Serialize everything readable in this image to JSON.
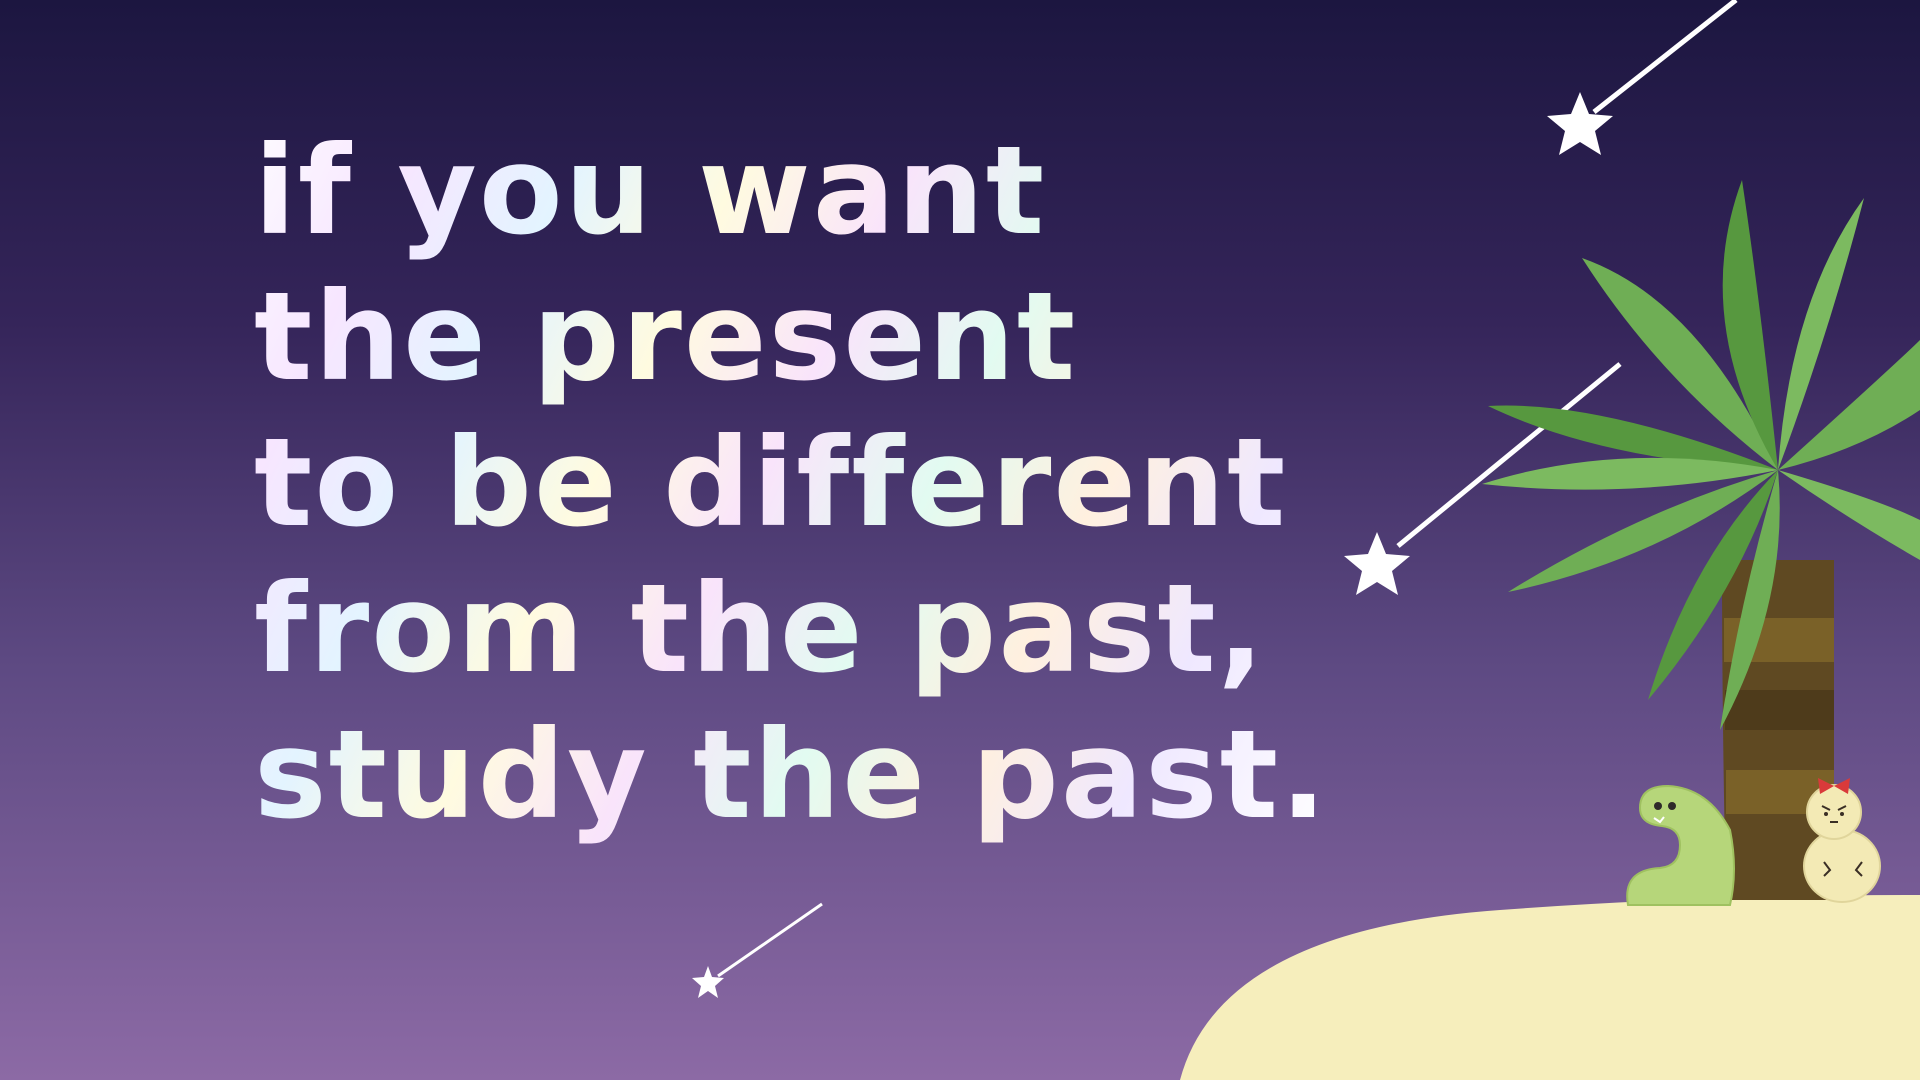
{
  "quote": {
    "lines": [
      "if you want",
      "the present",
      "to be different",
      "from the past,",
      "study the past."
    ]
  },
  "colors": {
    "sky_top": "#1c1640",
    "sky_bottom": "#8c6aa5",
    "sand": "#f6eebc",
    "palm_leaf": "#6fae55",
    "palm_leaf_dark": "#57983f",
    "trunk": "#5f4922",
    "worm": "#b6d67a",
    "chick": "#f3eab5",
    "bow": "#d93a3a"
  },
  "icons": [
    "star-icon",
    "palm-tree",
    "worm-character",
    "chick-character"
  ]
}
